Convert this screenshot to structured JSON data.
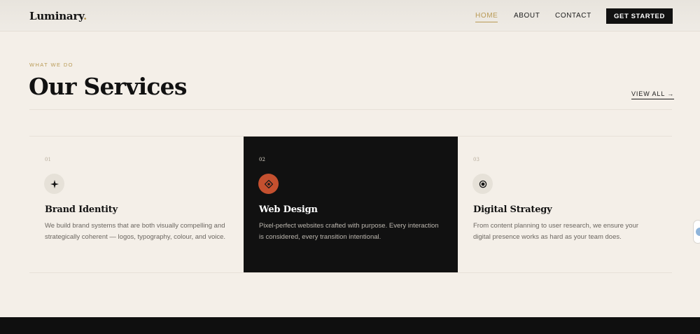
{
  "header": {
    "logo": "Luminary",
    "logo_dot": ".",
    "nav": [
      "HOME",
      "ABOUT",
      "CONTACT"
    ],
    "cta": "GET STARTED"
  },
  "section": {
    "eyebrow": "WHAT WE DO",
    "title": "Our Services",
    "view_all": "VIEW ALL →"
  },
  "cards": [
    {
      "num": "01",
      "icon": "sparkle-icon",
      "title": "Brand Identity",
      "desc": "We build brand systems that are both visually compelling and strategically coherent — logos, typography, colour, and voice."
    },
    {
      "num": "02",
      "icon": "diamond-target-icon",
      "title": "Web Design",
      "desc": "Pixel-perfect websites crafted with purpose. Every interaction is considered, every transition intentional."
    },
    {
      "num": "03",
      "icon": "target-icon",
      "title": "Digital Strategy",
      "desc": "From content planning to user research, we ensure your digital presence works as hard as your team does."
    }
  ],
  "colors": {
    "background": "#f4efe8",
    "accent_gold": "#b99a55",
    "dark": "#111111",
    "icon_orange": "#c4502f"
  }
}
